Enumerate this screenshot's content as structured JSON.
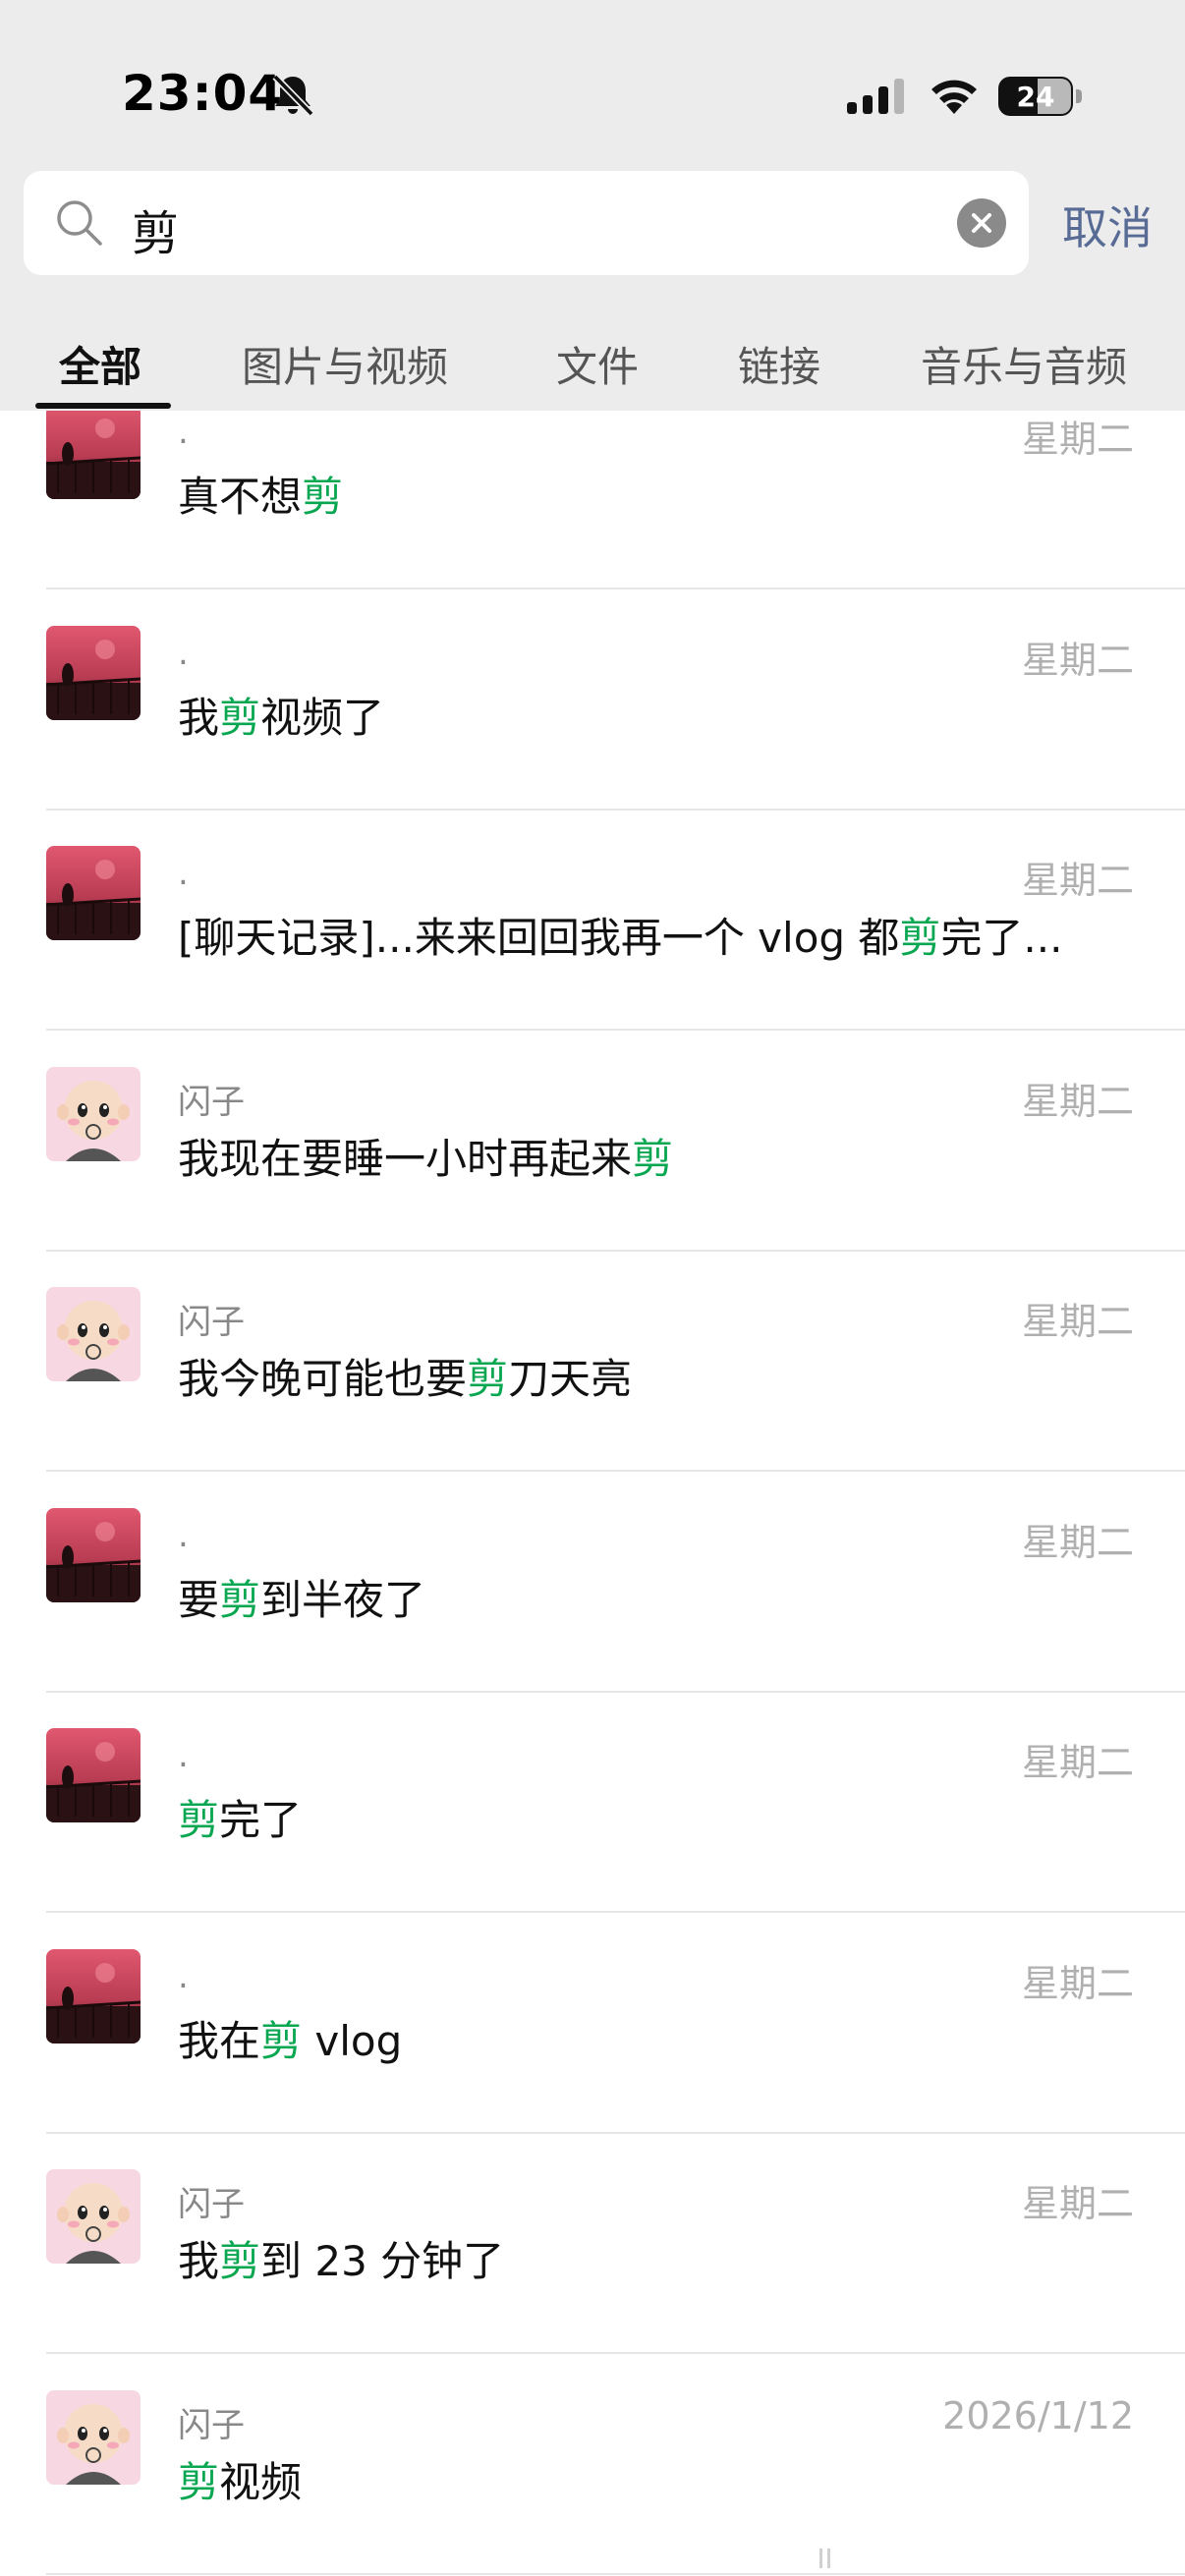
{
  "status_bar": {
    "time": "23:04",
    "battery": "24",
    "icons": [
      "bell-slash-icon",
      "cellular-signal-icon",
      "wifi-icon",
      "battery-icon"
    ]
  },
  "search": {
    "query": "剪",
    "cancel_label": "取消",
    "icons": [
      "search-icon",
      "clear-icon"
    ]
  },
  "tabs": [
    {
      "label": "全部",
      "active": true
    },
    {
      "label": "图片与视频"
    },
    {
      "label": "文件"
    },
    {
      "label": "链接"
    },
    {
      "label": "音乐与音频"
    }
  ],
  "results": [
    {
      "name": ".",
      "date": "星期二",
      "avatar": "sunset-fence",
      "msg": [
        [
          "真不想",
          false
        ],
        [
          "剪",
          true
        ]
      ]
    },
    {
      "name": ".",
      "date": "星期二",
      "avatar": "sunset-fence",
      "msg": [
        [
          "我",
          false
        ],
        [
          "剪",
          true
        ],
        [
          "视频了",
          false
        ]
      ]
    },
    {
      "name": ".",
      "date": "星期二",
      "avatar": "sunset-fence",
      "msg": [
        [
          "[聊天记录]...来来回回我再一个 vlog 都",
          false
        ],
        [
          "剪",
          true
        ],
        [
          "完了...",
          false
        ]
      ]
    },
    {
      "name": "闪子",
      "date": "星期二",
      "avatar": "cartoon-baby",
      "msg": [
        [
          "我现在要睡一小时再起来",
          false
        ],
        [
          "剪",
          true
        ]
      ]
    },
    {
      "name": "闪子",
      "date": "星期二",
      "avatar": "cartoon-baby",
      "msg": [
        [
          "我今晚可能也要",
          false
        ],
        [
          "剪",
          true
        ],
        [
          "刀天亮",
          false
        ]
      ]
    },
    {
      "name": ".",
      "date": "星期二",
      "avatar": "sunset-fence",
      "msg": [
        [
          "要",
          false
        ],
        [
          "剪",
          true
        ],
        [
          "到半夜了",
          false
        ]
      ]
    },
    {
      "name": ".",
      "date": "星期二",
      "avatar": "sunset-fence",
      "msg": [
        [
          "剪",
          true
        ],
        [
          "完了",
          false
        ]
      ]
    },
    {
      "name": ".",
      "date": "星期二",
      "avatar": "sunset-fence",
      "msg": [
        [
          "我在",
          false
        ],
        [
          "剪",
          true
        ],
        [
          " vlog",
          false
        ]
      ]
    },
    {
      "name": "闪子",
      "date": "星期二",
      "avatar": "cartoon-baby",
      "msg": [
        [
          "我",
          false
        ],
        [
          "剪",
          true
        ],
        [
          "到 23 分钟了",
          false
        ]
      ]
    },
    {
      "name": "闪子",
      "date": "2026/1/12",
      "avatar": "cartoon-baby",
      "msg": [
        [
          "剪",
          true
        ],
        [
          "视频",
          false
        ]
      ]
    }
  ],
  "colors": {
    "highlight": "#07a650",
    "link": "#576b95",
    "header_bg": "#ececec",
    "meta_text": "#b0b0b0"
  }
}
